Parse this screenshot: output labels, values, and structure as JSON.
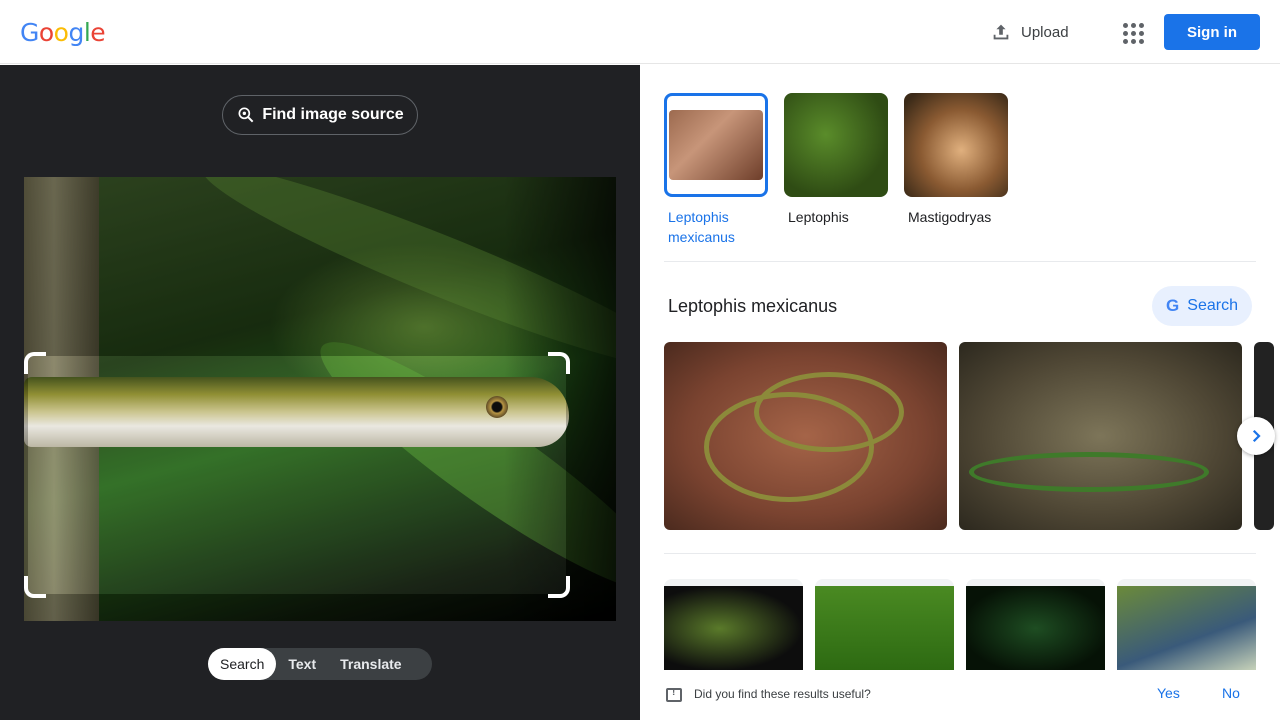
{
  "header": {
    "logo_letters": [
      "G",
      "o",
      "o",
      "g",
      "l",
      "e"
    ],
    "logo_colors": [
      "#4285F4",
      "#EA4335",
      "#FBBC05",
      "#4285F4",
      "#34A853",
      "#EA4335"
    ],
    "upload_label": "Upload",
    "signin_label": "Sign in",
    "accent": "#1a73e8"
  },
  "left_panel": {
    "find_source_label": "Find image source",
    "modes": [
      "Search",
      "Text",
      "Translate"
    ],
    "active_mode": "Search"
  },
  "right_panel": {
    "suggestions": [
      {
        "label": "Leptophis mexicanus",
        "selected": true
      },
      {
        "label": "Leptophis",
        "selected": false
      },
      {
        "label": "Mastigodryas",
        "selected": false
      }
    ],
    "result_title": "Leptophis mexicanus",
    "search_button_label": "Search",
    "feedback": {
      "question": "Did you find these results useful?",
      "yes": "Yes",
      "no": "No"
    }
  }
}
